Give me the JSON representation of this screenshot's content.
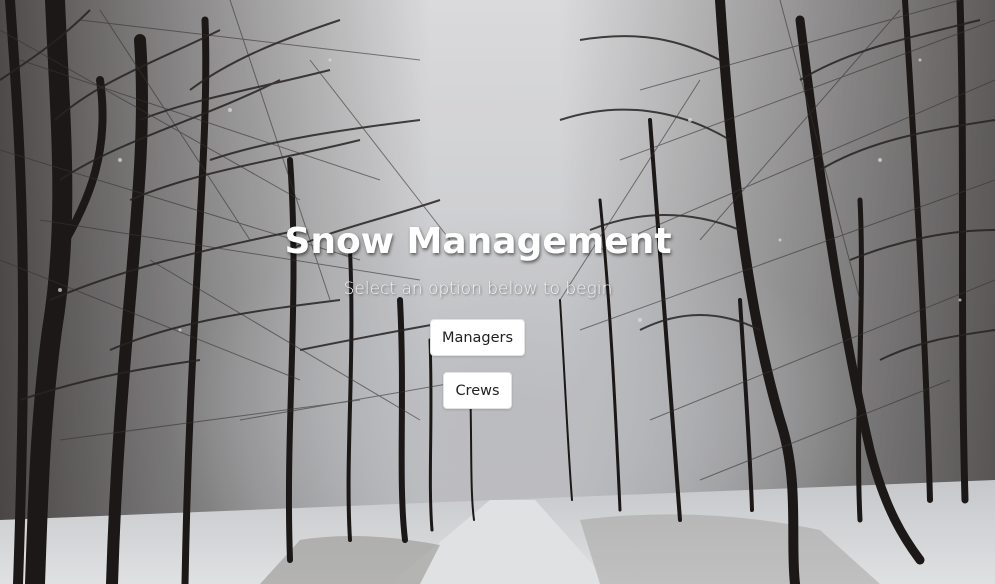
{
  "hero": {
    "title": "Snow Management",
    "subtitle": "Select an option below to begin"
  },
  "actions": {
    "managers_label": "Managers",
    "crews_label": "Crews"
  },
  "background": {
    "description_icon": "snowy-forest-photo",
    "sky_color": "#e9e9eb",
    "snow_color": "#f1f2f4",
    "trunk_color": "#1e1a18"
  }
}
